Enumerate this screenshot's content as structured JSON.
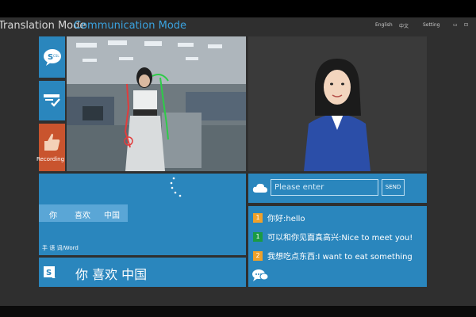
{
  "header": {
    "translation_mode": "Translation Mode",
    "communication_mode": "Communication Mode",
    "links": [
      "English",
      "中文",
      "Setting"
    ]
  },
  "window_controls": {
    "minimize": "▭",
    "close": "⊡"
  },
  "tiles": {
    "sign_icon": "sign-language-icon",
    "check_icon": "check-list-icon",
    "record_label": "Recording"
  },
  "sign_panel": {
    "words": [
      "你",
      "喜欢",
      "中国"
    ],
    "footer": "手 语 词/Word"
  },
  "result": {
    "text": "你 喜欢 中国"
  },
  "input": {
    "placeholder": "Please enter",
    "send_label": "SEND"
  },
  "chat": [
    {
      "badge": "1",
      "badge_color": "#f0a12a",
      "text": "你好:hello"
    },
    {
      "badge": "1",
      "badge_color": "#1a9b43",
      "text": "可以和你见面真高兴:Nice to meet you!"
    },
    {
      "badge": "2",
      "badge_color": "#f0a12a",
      "text": "我想吃点东西:I want to eat something"
    }
  ],
  "colors": {
    "panel_blue": "#2a86bd",
    "record_orange": "#c9542e",
    "accent": "#3aa3e0"
  }
}
